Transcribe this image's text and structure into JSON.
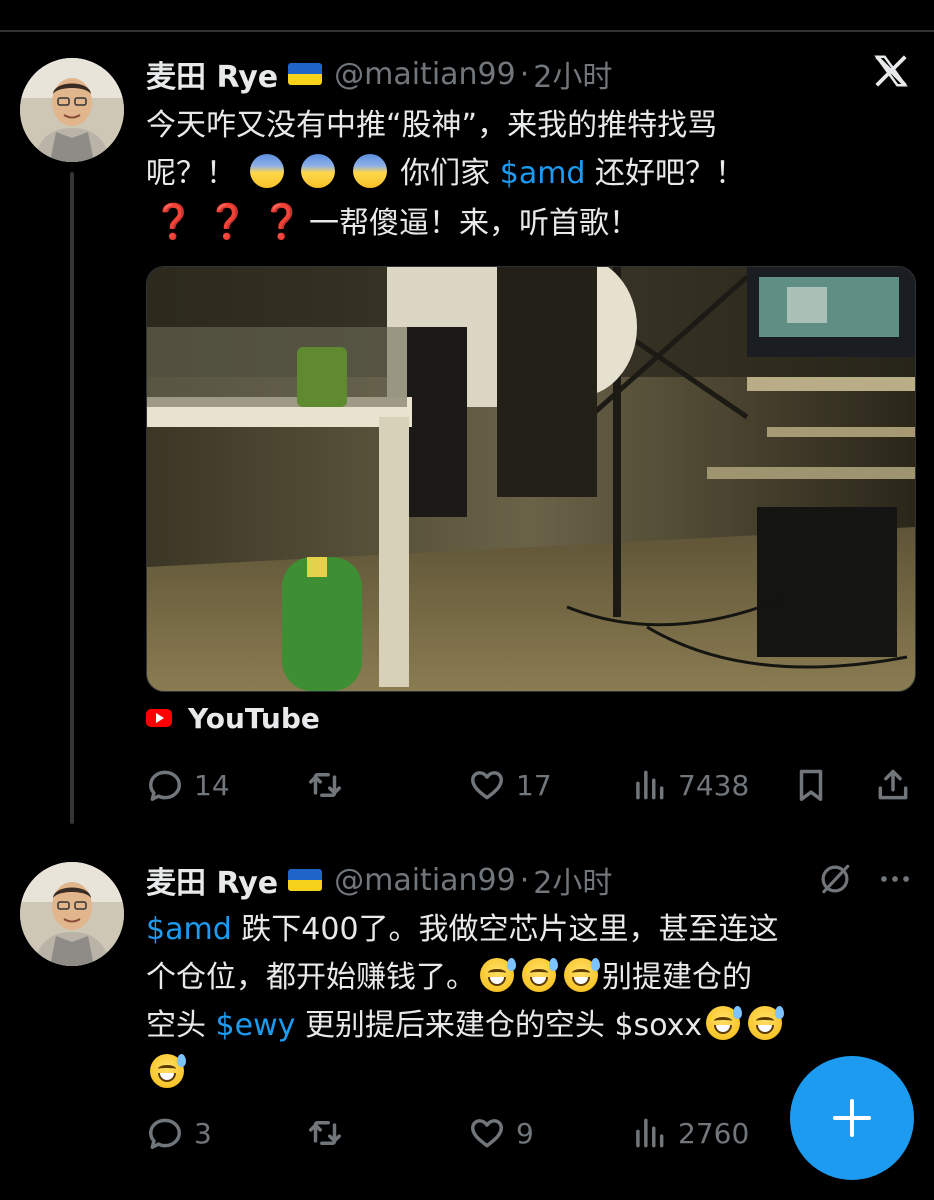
{
  "tweet1": {
    "name": "麦田 Rye",
    "handle": "@maitian99",
    "separator": "·",
    "time": "2小时",
    "line1": "今天咋又没有中推“股神”，来我的推特找骂",
    "line2_a": "呢？！",
    "line2_b": "你们家",
    "line2_cashtag": "$amd",
    "line2_c": "还好吧？！",
    "line3_q": "❓",
    "line3_text": "一帮傻逼！来，听首歌！",
    "link_source": "YouTube",
    "replies": "14",
    "retweets": "",
    "likes": "17",
    "views": "7438"
  },
  "tweet2": {
    "name": "麦田 Rye",
    "handle": "@maitian99",
    "separator": "·",
    "time": "2小时",
    "line1_cashtag": "$amd",
    "line1_text": "跌下400了。我做空芯片这里，甚至连这",
    "line2_text": "个仓位，都开始赚钱了。",
    "line2_tail": "别提建仓的",
    "line3_a": "空头",
    "line3_cashtag": "$ewy",
    "line3_b": "更别提后来建仓的空头 $soxx",
    "replies": "3",
    "likes": "9",
    "views": "2760"
  },
  "icons": {
    "x_logo": "x-logo-icon",
    "reply": "reply-icon",
    "retweet": "retweet-icon",
    "like": "heart-icon",
    "views": "views-icon",
    "bookmark": "bookmark-icon",
    "share": "share-icon",
    "grok": "grok-icon",
    "more": "more-icon",
    "compose": "compose-plus-icon"
  },
  "colors": {
    "background": "#000000",
    "text": "#e7e9ea",
    "muted": "#71767b",
    "accent": "#1d9bf0",
    "youtube_red": "#ff0000"
  }
}
